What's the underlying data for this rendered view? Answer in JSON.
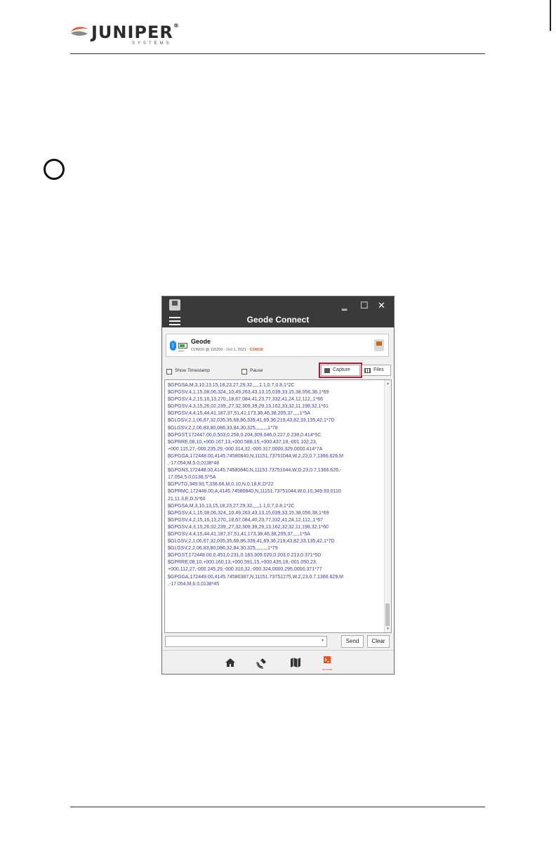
{
  "brand": {
    "name": "JUNIPER",
    "registered": "®",
    "subtitle": "SYSTEMS"
  },
  "window": {
    "title": "Geode Connect",
    "minimize": "‗",
    "maximize": "☐",
    "close": "✕"
  },
  "device": {
    "name": "Geode",
    "battery_label": "96%",
    "info": "COM10 @ 115200 - Oct 1, 2021 - ",
    "port": "COM10"
  },
  "controls": {
    "show_timestamp": "Show Timestamp",
    "pause": "Pause",
    "capture": "Capture",
    "files": "Files"
  },
  "terminal": {
    "lines": [
      "$GPGSA,M,3,10,13,15,18,23,27,29,32,,,,,1.1,0.7,0.8,1*2C",
      "$GPGSV,4,1,15,08,06,324,,10,49,263,43,13,15,039,33,15,38,056,38,1*69",
      "$GPGSV,4,2,15,16,13,270,,18,67,084,41,23,77,332,41,24,12,112,,1*66",
      "$GPGSV,4,3,15,26,02,239,,27,32,309,39,29,13,162,33,32,11,198,32,1*61",
      "$GPGSV,4,4,15,44,41,187,37,51,41,173,38,46,38,205,37,,,,,1*5A",
      "$GLGSV,2,1,06,67,32,035,35,68,86,339,41,69,36,219,43,82,33,135,42,1*7D",
      "$GLGSV,2,2,06,83,80,086,33,84,30,325,,,,,,,,,1*78",
      "$GPGST,172447.00,0.503,0.258,0.204,309.046,0.227,0.238,0.414*5C",
      "$GPRRE,08,10,+000.167,13,+000.588,15,+000.437,18,-001.102,23,",
      "+000.115,27,-000.235,29,-000.314,32,-000.317,0000.329,0000.414*7A",
      "$GPGGA,172448.00,4145.74580840,N,11151.73751044,W,2,23,0.7,1366.626,M",
      ",-17.054,M,5.0,0138*48",
      "$GPGNS,172448.00,4145.74580840,N,11151.73751044,W,D,23,0.7,1366.626,-",
      "17.054,5.0,0138,S*5A",
      "$GPVTG,349.93,T,338.66,M,0.10,N,0.18,K,D*22",
      "$GPRMC,172448.00,A,4145.74580840,N,11151.73751044,W,0.10,349.93,0110",
      "21,11.3,E,D,S*60",
      "$GPGSA,M,3,10,13,15,18,23,27,29,32,,,,,1.1,0.7,0.8,1*2C",
      "$GPGSV,4,1,15,08,06,324,,10,49,263,43,13,15,039,33,15,38,056,38,1*69",
      "$GPGSV,4,2,15,16,13,270,,18,67,084,40,23,77,332,41,24,12,112,,1*67",
      "$GPGSV,4,3,15,26,02,239,,27,32,309,39,29,13,162,32,32,11,198,32,1*60",
      "$GPGSV,4,4,15,44,41,187,37,51,41,173,38,46,38,205,37,,,,,1*5A",
      "$GLGSV,2,1,06,67,32,035,35,68,86,339,41,69,36,219,43,82,33,135,42,1*7D",
      "$GLGSV,2,2,06,83,80,086,32,84,30,325,,,,,,,,,1*79",
      "$GPGST,172448.00,0.451,0.231,0.183,309.020,0.203,0.213,0.371*5D",
      "$GPRRE,08,10,+000.160,13,+000.591,15,+000.435,18,-001.050,23,",
      "+000.112,27,-000.245,29,-000.310,32,-000.324,0000.295,0000.371*77",
      "$GPGGA,172449.00,4145.74580387,N,11151.73751275,W,2,23,0.7,1366.629,M",
      ",-17.054,M,6.0,0138*45"
    ]
  },
  "input": {
    "value": "",
    "send": "Send",
    "clear": "Clear"
  },
  "nav": {
    "terminal_label": "terminal"
  },
  "colors": {
    "titlebar": "#3a3a3a",
    "terminal_text": "#3c3c96",
    "highlight": "#c8102e",
    "accent": "#e8541e"
  }
}
